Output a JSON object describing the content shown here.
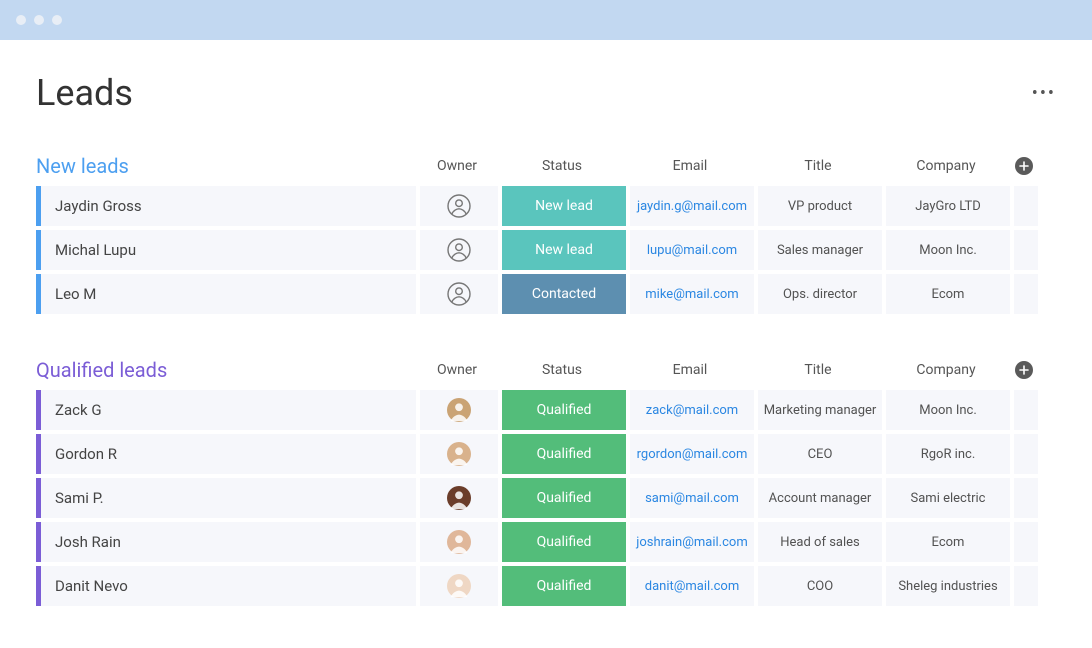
{
  "page_title": "Leads",
  "columns": {
    "owner": "Owner",
    "status": "Status",
    "email": "Email",
    "title": "Title",
    "company": "Company"
  },
  "groups": [
    {
      "id": "new_leads",
      "title": "New leads",
      "color": "blue",
      "rows": [
        {
          "name": "Jaydin Gross",
          "owner_type": "icon",
          "status": "New lead",
          "status_class": "status-newlead",
          "email": "jaydin.g@mail.com",
          "title": "VP product",
          "company": "JayGro LTD"
        },
        {
          "name": "Michal Lupu",
          "owner_type": "icon",
          "status": "New lead",
          "status_class": "status-newlead",
          "email": "lupu@mail.com",
          "title": "Sales manager",
          "company": "Moon Inc."
        },
        {
          "name": "Leo M",
          "owner_type": "icon",
          "status": "Contacted",
          "status_class": "status-contacted",
          "email": "mike@mail.com",
          "title": "Ops. director",
          "company": "Ecom"
        }
      ]
    },
    {
      "id": "qualified_leads",
      "title": "Qualified leads",
      "color": "purple",
      "rows": [
        {
          "name": "Zack G",
          "owner_type": "avatar",
          "avatar_bg": "#caa374",
          "status": "Qualified",
          "status_class": "status-qualified",
          "email": "zack@mail.com",
          "title": "Marketing manager",
          "company": "Moon Inc."
        },
        {
          "name": "Gordon R",
          "owner_type": "avatar",
          "avatar_bg": "#d9b28c",
          "status": "Qualified",
          "status_class": "status-qualified",
          "email": "rgordon@mail.com",
          "title": "CEO",
          "company": "RgoR inc."
        },
        {
          "name": "Sami P.",
          "owner_type": "avatar",
          "avatar_bg": "#6b3d2a",
          "status": "Qualified",
          "status_class": "status-qualified",
          "email": "sami@mail.com",
          "title": "Account manager",
          "company": "Sami electric"
        },
        {
          "name": "Josh Rain",
          "owner_type": "avatar",
          "avatar_bg": "#e0b79a",
          "status": "Qualified",
          "status_class": "status-qualified",
          "email": "joshrain@mail.com",
          "title": "Head of sales",
          "company": "Ecom"
        },
        {
          "name": "Danit Nevo",
          "owner_type": "avatar",
          "avatar_bg": "#efd7c4",
          "status": "Qualified",
          "status_class": "status-qualified",
          "email": "danit@mail.com",
          "title": "COO",
          "company": "Sheleg industries"
        }
      ]
    }
  ]
}
